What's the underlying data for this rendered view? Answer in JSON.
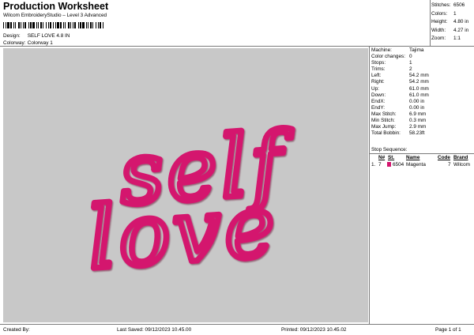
{
  "header": {
    "title": "Production Worksheet",
    "subtitle": "Wilcom EmbroideryStudio – Level 3 Advanced",
    "design_label": "Design:",
    "design_value": "SELF LOVE 4.8 IN",
    "colorway_label": "Colorway:",
    "colorway_value": "Colorway 1"
  },
  "stats": [
    {
      "label": "Stitches:",
      "value": "6506"
    },
    {
      "label": "Colors:",
      "value": "1"
    },
    {
      "label": "Height:",
      "value": "4.80 in"
    },
    {
      "label": "Width:",
      "value": "4.27 in"
    },
    {
      "label": "Zoom:",
      "value": "1:1"
    }
  ],
  "design": {
    "line1": "self",
    "line2": "love",
    "thread_color": "#d4146e",
    "background_color": "#c8c8c8"
  },
  "machine_info": [
    {
      "label": "Machine:",
      "value": "Tajima"
    },
    {
      "label": "Color changes:",
      "value": "0"
    },
    {
      "label": "Stops:",
      "value": "1"
    },
    {
      "label": "Trims:",
      "value": "2"
    },
    {
      "label": "Left:",
      "value": "54.2 mm"
    },
    {
      "label": "Right:",
      "value": "54.2 mm"
    },
    {
      "label": "Up:",
      "value": "61.0 mm"
    },
    {
      "label": "Down:",
      "value": "61.0 mm"
    },
    {
      "label": "EndX:",
      "value": "0.00 in"
    },
    {
      "label": "EndY:",
      "value": "0.00 in"
    },
    {
      "label": "Max Stitch:",
      "value": "6.9 mm"
    },
    {
      "label": "Min Stitch:",
      "value": "0.3 mm"
    },
    {
      "label": "Max Jump:",
      "value": "2.9 mm"
    },
    {
      "label": "Total Bobbin:",
      "value": "58.23ft"
    }
  ],
  "stop_sequence": {
    "title": "Stop Sequence:",
    "headers": [
      "N#",
      "St.",
      "Name",
      "Code",
      "Brand"
    ],
    "rows": [
      {
        "index": "1.",
        "n": "7",
        "st": "6504",
        "name": "Magenta",
        "code": "7",
        "brand": "Wilcom",
        "color": "#d4146e"
      }
    ]
  },
  "footer": {
    "created_by": "Created By:",
    "last_saved": "Last Saved: 09/12/2023 10.45.00",
    "printed": "Printed: 09/12/2023 10.45.02",
    "page": "Page 1 of 1"
  }
}
